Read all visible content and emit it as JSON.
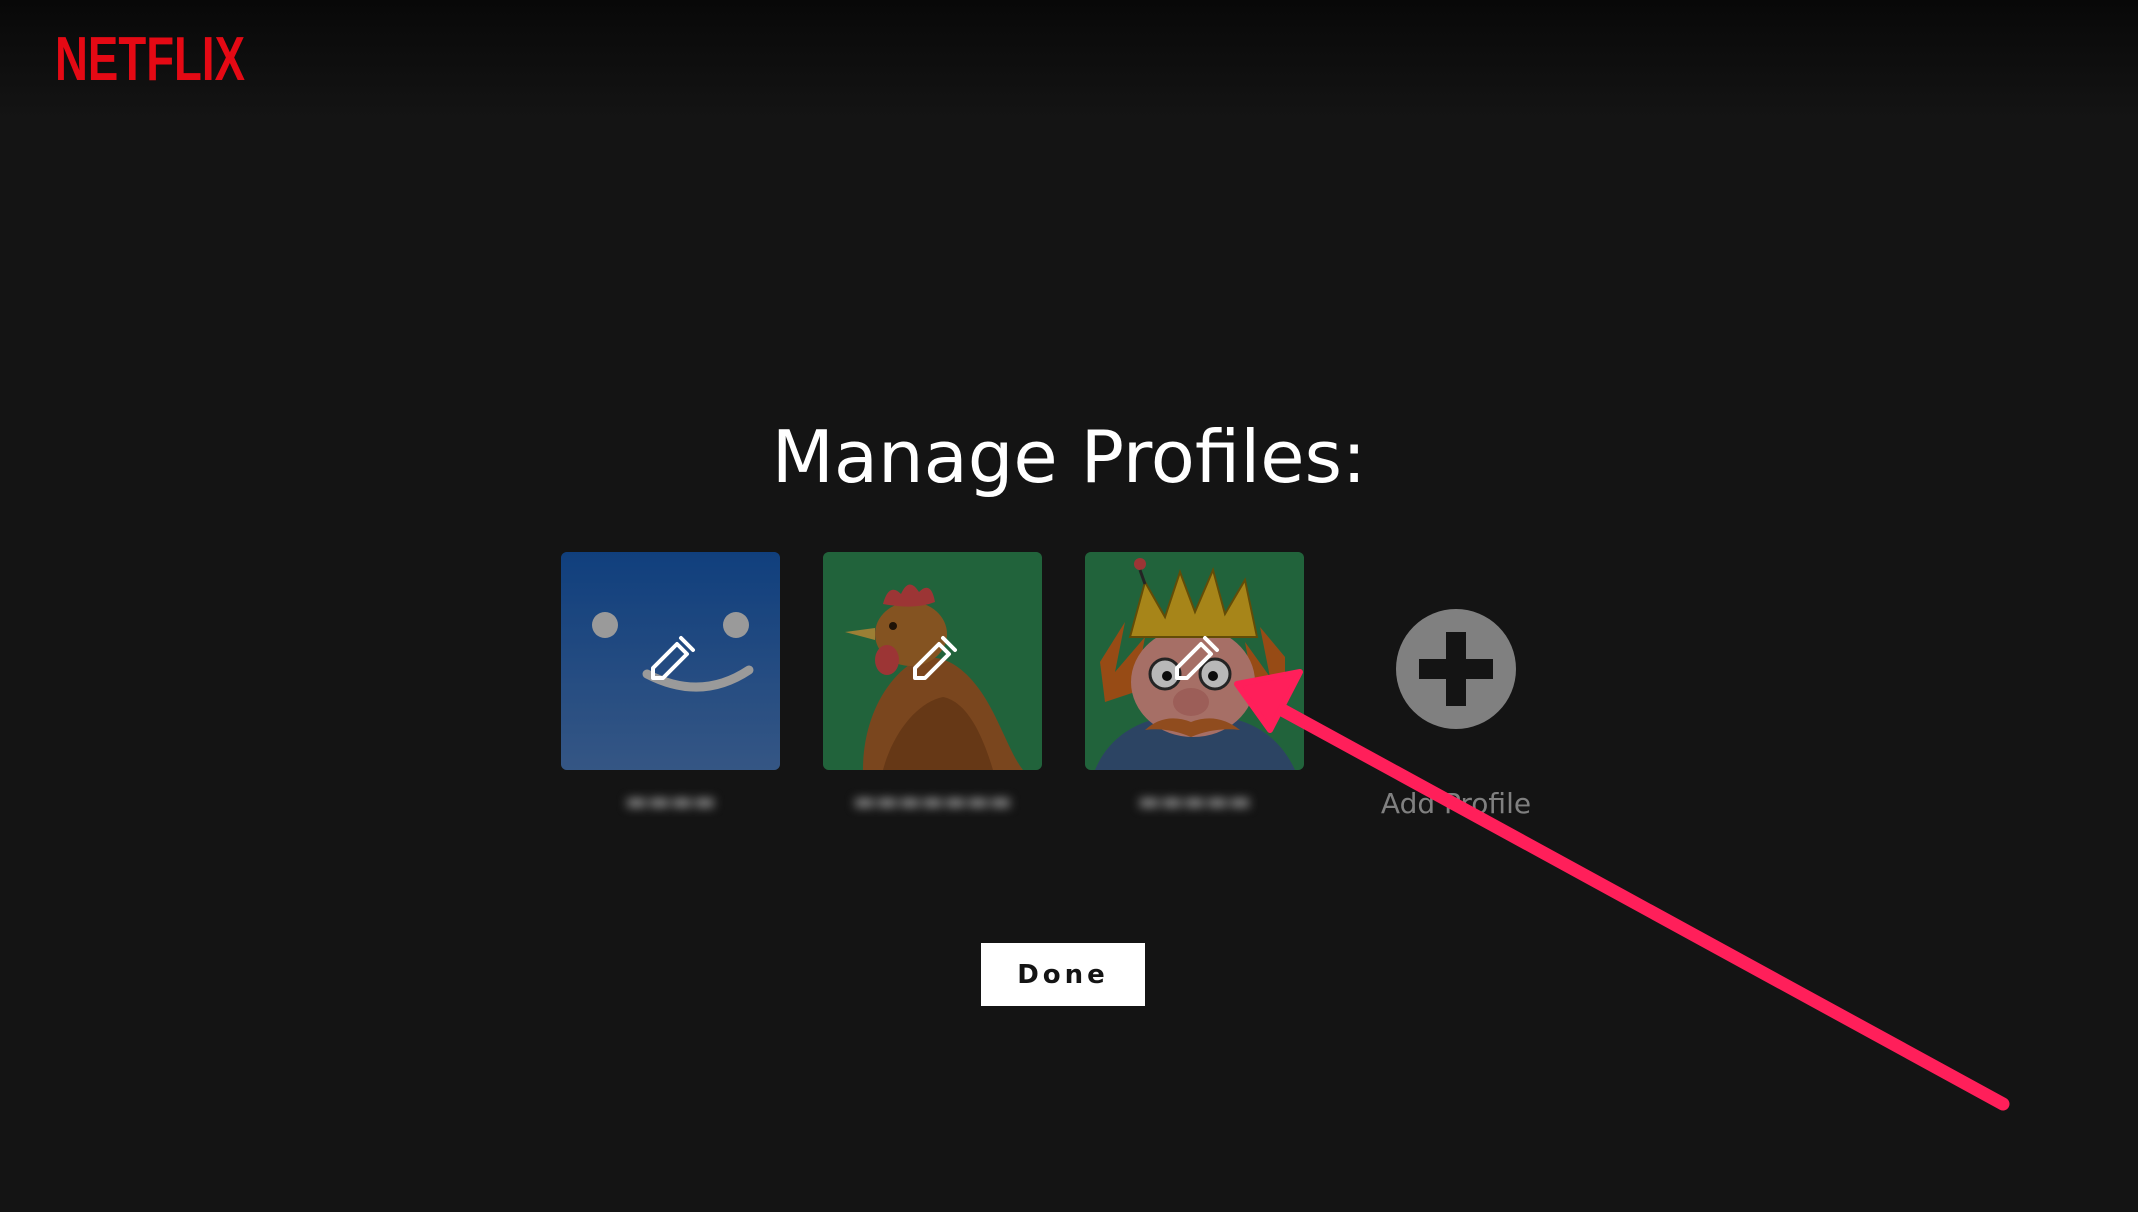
{
  "brand": {
    "name": "NETFLIX",
    "color": "#E50914"
  },
  "page": {
    "title": "Manage Profiles:"
  },
  "profiles": [
    {
      "avatar": "blue-smiley-face",
      "avatar_color": "#1E4A8C",
      "edit_icon": "pencil-icon"
    },
    {
      "avatar": "chicken-photo",
      "avatar_color": "#2E8B57",
      "edit_icon": "pencil-icon"
    },
    {
      "avatar": "cartoon-king",
      "avatar_color": "#2E8B57",
      "edit_icon": "pencil-icon"
    }
  ],
  "add_profile": {
    "label": "Add Profile",
    "icon": "plus-circle-icon"
  },
  "actions": {
    "done_label": "Done"
  },
  "annotation": {
    "icon": "pointer-arrow",
    "color": "#FF1F5A"
  }
}
